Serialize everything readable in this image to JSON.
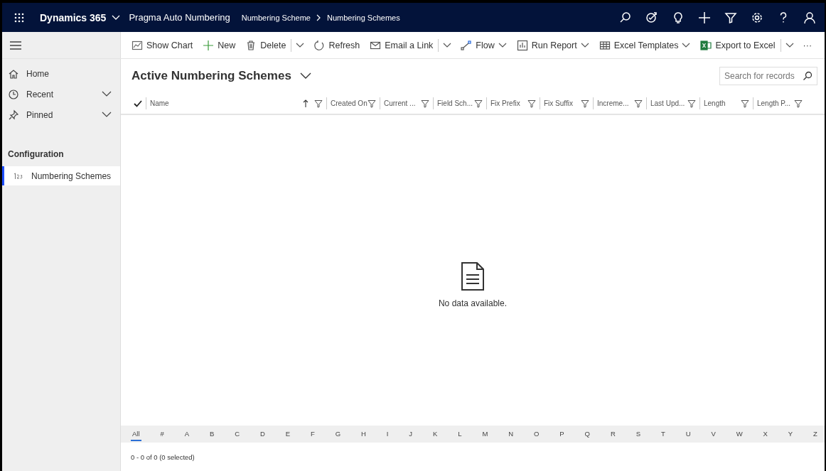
{
  "top_bar": {
    "app_name": "Dynamics 365",
    "module": "Pragma Auto Numbering",
    "breadcrumb": [
      "Numbering Scheme",
      "Numbering Schemes"
    ]
  },
  "sidebar": {
    "items": [
      {
        "label": "Home"
      },
      {
        "label": "Recent",
        "expanded": false
      },
      {
        "label": "Pinned",
        "expanded": false
      }
    ],
    "group": "Configuration",
    "group_items": [
      {
        "label": "Numbering Schemes",
        "selected": true
      }
    ]
  },
  "commands": [
    {
      "label": "Show Chart"
    },
    {
      "label": "New"
    },
    {
      "label": "Delete",
      "split_menu": true
    },
    {
      "label": "Refresh"
    },
    {
      "label": "Email a Link",
      "split_menu": true
    },
    {
      "label": "Flow",
      "menu_chevron": true
    },
    {
      "label": "Run Report",
      "menu_chevron": true
    },
    {
      "label": "Excel Templates",
      "menu_chevron": true
    },
    {
      "label": "Export to Excel",
      "split_menu": true
    },
    {
      "label": "···"
    }
  ],
  "view": {
    "title": "Active Numbering Schemes",
    "search": {
      "placeholder": "Search for records"
    }
  },
  "columns": [
    {
      "label": "Name",
      "sorted_ascending": true
    },
    {
      "label": "Created On"
    },
    {
      "label": "Current ..."
    },
    {
      "label": "Field Sch..."
    },
    {
      "label": "Fix Prefix"
    },
    {
      "label": "Fix Suffix"
    },
    {
      "label": "Increme..."
    },
    {
      "label": "Last Upd..."
    },
    {
      "label": "Length"
    },
    {
      "label": "Length P..."
    }
  ],
  "empty_message": "No data available.",
  "jump_bar": [
    {
      "label": "All",
      "selected": true
    },
    {
      "label": "#",
      "selected": false
    },
    {
      "label": "A",
      "selected": false
    },
    {
      "label": "B",
      "selected": false
    },
    {
      "label": "C",
      "selected": false
    },
    {
      "label": "D",
      "selected": false
    },
    {
      "label": "E",
      "selected": false
    },
    {
      "label": "F",
      "selected": false
    },
    {
      "label": "G",
      "selected": false
    },
    {
      "label": "H",
      "selected": false
    },
    {
      "label": "I",
      "selected": false
    },
    {
      "label": "J",
      "selected": false
    },
    {
      "label": "K",
      "selected": false
    },
    {
      "label": "L",
      "selected": false
    },
    {
      "label": "M",
      "selected": false
    },
    {
      "label": "N",
      "selected": false
    },
    {
      "label": "O",
      "selected": false
    },
    {
      "label": "P",
      "selected": false
    },
    {
      "label": "Q",
      "selected": false
    },
    {
      "label": "R",
      "selected": false
    },
    {
      "label": "S",
      "selected": false
    },
    {
      "label": "T",
      "selected": false
    },
    {
      "label": "U",
      "selected": false
    },
    {
      "label": "V",
      "selected": false
    },
    {
      "label": "W",
      "selected": false
    },
    {
      "label": "X",
      "selected": false
    },
    {
      "label": "Y",
      "selected": false
    },
    {
      "label": "Z",
      "selected": false
    }
  ],
  "status": "0 - 0 of 0 (0 selected)"
}
